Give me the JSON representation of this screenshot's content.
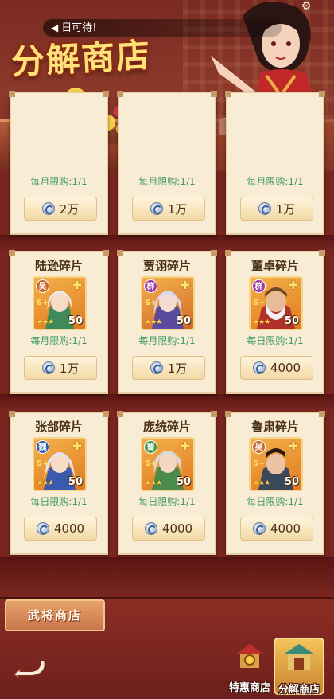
{
  "header": {
    "notice": "日可待!",
    "title": "分解商店"
  },
  "shop": {
    "top_row": [
      {
        "limit": "每月限购:1/1",
        "price": "2万"
      },
      {
        "limit": "每月限购:1/1",
        "price": "1万"
      },
      {
        "limit": "每月限购:1/1",
        "price": "1万"
      }
    ],
    "items": [
      {
        "name": "陆逊碎片",
        "faction": "吴",
        "faction_color": "#c9672a",
        "level": "50",
        "limit": "每月限购:1/1",
        "price": "1万"
      },
      {
        "name": "贾诩碎片",
        "faction": "群",
        "faction_color": "#9a3aa0",
        "level": "50",
        "limit": "每月限购:1/1",
        "price": "1万"
      },
      {
        "name": "董卓碎片",
        "faction": "群",
        "faction_color": "#9a3aa0",
        "level": "50",
        "limit": "每日限购:1/1",
        "price": "4000"
      },
      {
        "name": "张郃碎片",
        "faction": "魏",
        "faction_color": "#2f5fb0",
        "level": "50",
        "limit": "每日限购:1/1",
        "price": "4000"
      },
      {
        "name": "庞统碎片",
        "faction": "蜀",
        "faction_color": "#3a9a4a",
        "level": "50",
        "limit": "每日限购:1/1",
        "price": "4000"
      },
      {
        "name": "鲁肃碎片",
        "faction": "吴",
        "faction_color": "#c9672a",
        "level": "50",
        "limit": "每日限购:1/1",
        "price": "4000"
      }
    ],
    "star_label": "S+",
    "stars": "★★★"
  },
  "bottom": {
    "general_shop": "武将商店",
    "nav": [
      {
        "label": "特惠商店",
        "icon": "gift-pavilion-icon"
      },
      {
        "label": "分解商店",
        "icon": "pavilion-icon"
      }
    ]
  },
  "colors": {
    "accent_gold": "#ffe27a",
    "limit_green": "#3f9a6a",
    "background": "#7a2620"
  }
}
